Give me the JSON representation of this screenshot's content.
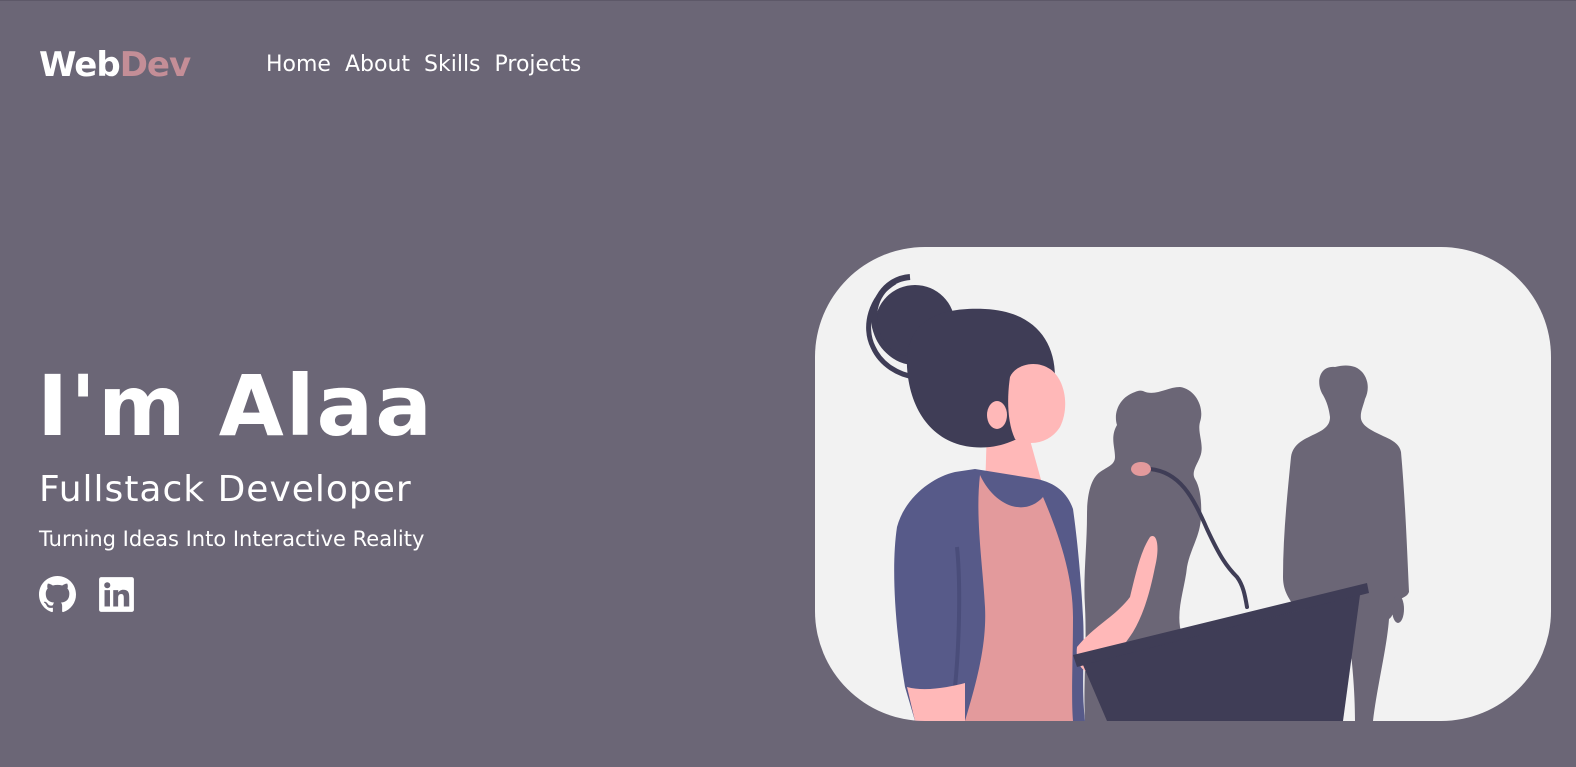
{
  "logo": {
    "part1": "Web",
    "part2": "Dev"
  },
  "nav": {
    "items": [
      {
        "label": "Home"
      },
      {
        "label": "About"
      },
      {
        "label": "Skills"
      },
      {
        "label": "Projects"
      }
    ]
  },
  "hero": {
    "title": "I'm Alaa",
    "role": "Fullstack Developer",
    "tagline": "Turning Ideas Into Interactive Reality"
  },
  "socials": [
    {
      "icon": "github-icon"
    },
    {
      "icon": "linkedin-icon"
    }
  ],
  "colors": {
    "background": "#6b6676",
    "accent": "#c48e97",
    "text": "#ffffff",
    "illustration_bg": "#f2f2f2",
    "dark": "#3f3d56",
    "jacket": "#575a89",
    "skin": "#ffb8b8",
    "shirt": "#e39a9c",
    "silhouette": "#6b6676"
  }
}
